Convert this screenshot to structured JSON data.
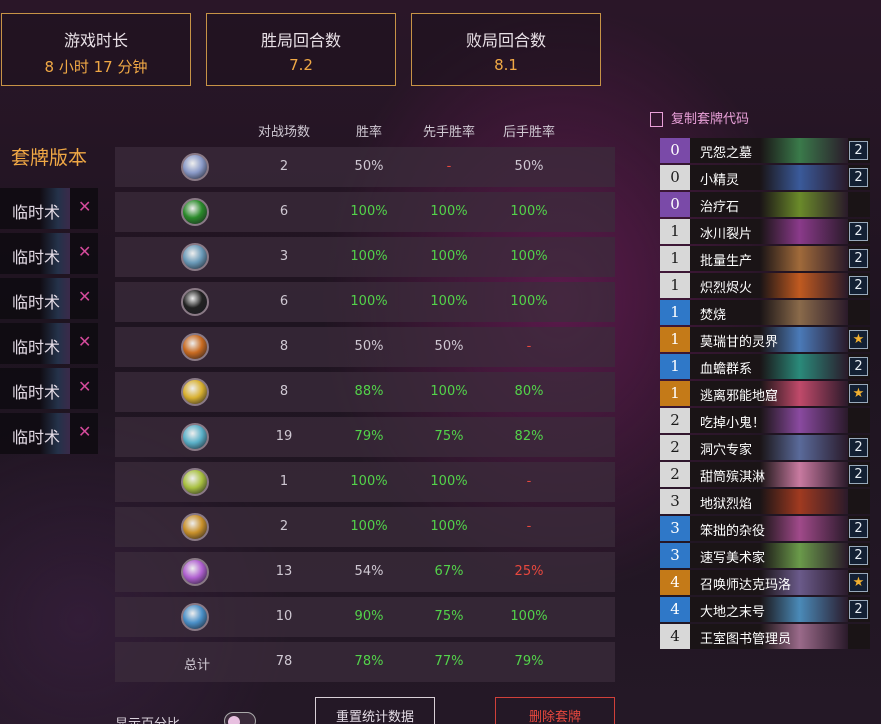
{
  "stats": [
    {
      "title": "游戏时长",
      "value": "8 小时 17 分钟"
    },
    {
      "title": "胜局回合数",
      "value": "7.2"
    },
    {
      "title": "败局回合数",
      "value": "8.1"
    }
  ],
  "columns": [
    "对战场数",
    "胜率",
    "先手胜率",
    "后手胜率"
  ],
  "deck_versions_title": "套牌版本",
  "versions": [
    "临时术",
    "临时术",
    "临时术",
    "临时术",
    "临时术",
    "临时术"
  ],
  "rows": [
    {
      "icon": "class-icon-1",
      "games": "2",
      "win": "50%",
      "first": "-",
      "second": "50%"
    },
    {
      "icon": "class-icon-2",
      "games": "6",
      "win": "100%",
      "first": "100%",
      "second": "100%"
    },
    {
      "icon": "class-icon-3",
      "games": "3",
      "win": "100%",
      "first": "100%",
      "second": "100%"
    },
    {
      "icon": "class-icon-4",
      "games": "6",
      "win": "100%",
      "first": "100%",
      "second": "100%"
    },
    {
      "icon": "class-icon-5",
      "games": "8",
      "win": "50%",
      "first": "50%",
      "second": "-"
    },
    {
      "icon": "class-icon-6",
      "games": "8",
      "win": "88%",
      "first": "100%",
      "second": "80%"
    },
    {
      "icon": "class-icon-7",
      "games": "19",
      "win": "79%",
      "first": "75%",
      "second": "82%"
    },
    {
      "icon": "class-icon-8",
      "games": "1",
      "win": "100%",
      "first": "100%",
      "second": "-"
    },
    {
      "icon": "class-icon-9",
      "games": "2",
      "win": "100%",
      "first": "100%",
      "second": "-"
    },
    {
      "icon": "class-icon-10",
      "games": "13",
      "win": "54%",
      "first": "67%",
      "second": "25%"
    },
    {
      "icon": "class-icon-11",
      "games": "10",
      "win": "90%",
      "first": "75%",
      "second": "100%"
    }
  ],
  "total": {
    "label": "总计",
    "games": "78",
    "win": "78%",
    "first": "77%",
    "second": "79%"
  },
  "copy_label": "复制套牌代码",
  "cards": [
    {
      "cost": "0",
      "name": "咒怨之墓",
      "count": "2",
      "rarity": "epic"
    },
    {
      "cost": "0",
      "name": "小精灵",
      "count": "2",
      "rarity": "common"
    },
    {
      "cost": "0",
      "name": "治疗石",
      "count": "",
      "rarity": "epic"
    },
    {
      "cost": "1",
      "name": "冰川裂片",
      "count": "2",
      "rarity": "common"
    },
    {
      "cost": "1",
      "name": "批量生产",
      "count": "2",
      "rarity": "common"
    },
    {
      "cost": "1",
      "name": "炽烈烬火",
      "count": "2",
      "rarity": "common"
    },
    {
      "cost": "1",
      "name": "焚烧",
      "count": "",
      "rarity": "rare"
    },
    {
      "cost": "1",
      "name": "莫瑞甘的灵界",
      "count": "★",
      "rarity": "legendary"
    },
    {
      "cost": "1",
      "name": "血蟾群系",
      "count": "2",
      "rarity": "rare"
    },
    {
      "cost": "1",
      "name": "逃离邪能地窟",
      "count": "★",
      "rarity": "legendary"
    },
    {
      "cost": "2",
      "name": "吃掉小鬼！",
      "count": "",
      "rarity": "common"
    },
    {
      "cost": "2",
      "name": "洞穴专家",
      "count": "2",
      "rarity": "common"
    },
    {
      "cost": "2",
      "name": "甜筒殡淇淋",
      "count": "2",
      "rarity": "common"
    },
    {
      "cost": "3",
      "name": "地狱烈焰",
      "count": "",
      "rarity": "common"
    },
    {
      "cost": "3",
      "name": "笨拙的杂役",
      "count": "2",
      "rarity": "rare"
    },
    {
      "cost": "3",
      "name": "速写美术家",
      "count": "2",
      "rarity": "rare"
    },
    {
      "cost": "4",
      "name": "召唤师达克玛洛",
      "count": "★",
      "rarity": "legendary"
    },
    {
      "cost": "4",
      "name": "大地之末号",
      "count": "2",
      "rarity": "rare"
    },
    {
      "cost": "4",
      "name": "王室图书管理员",
      "count": "",
      "rarity": "common"
    }
  ],
  "bottom": {
    "toggle_label": "显示百分比",
    "reset_label": "重置统计数据",
    "delete_label": "删除套牌"
  },
  "colors": {
    "accent": "#f0a845",
    "green": "#53d34a",
    "red": "#e8483e",
    "epic": "#7a4aa8",
    "rare": "#2f78c8",
    "legendary": "#c47a18",
    "common": "#d8d8d8"
  }
}
